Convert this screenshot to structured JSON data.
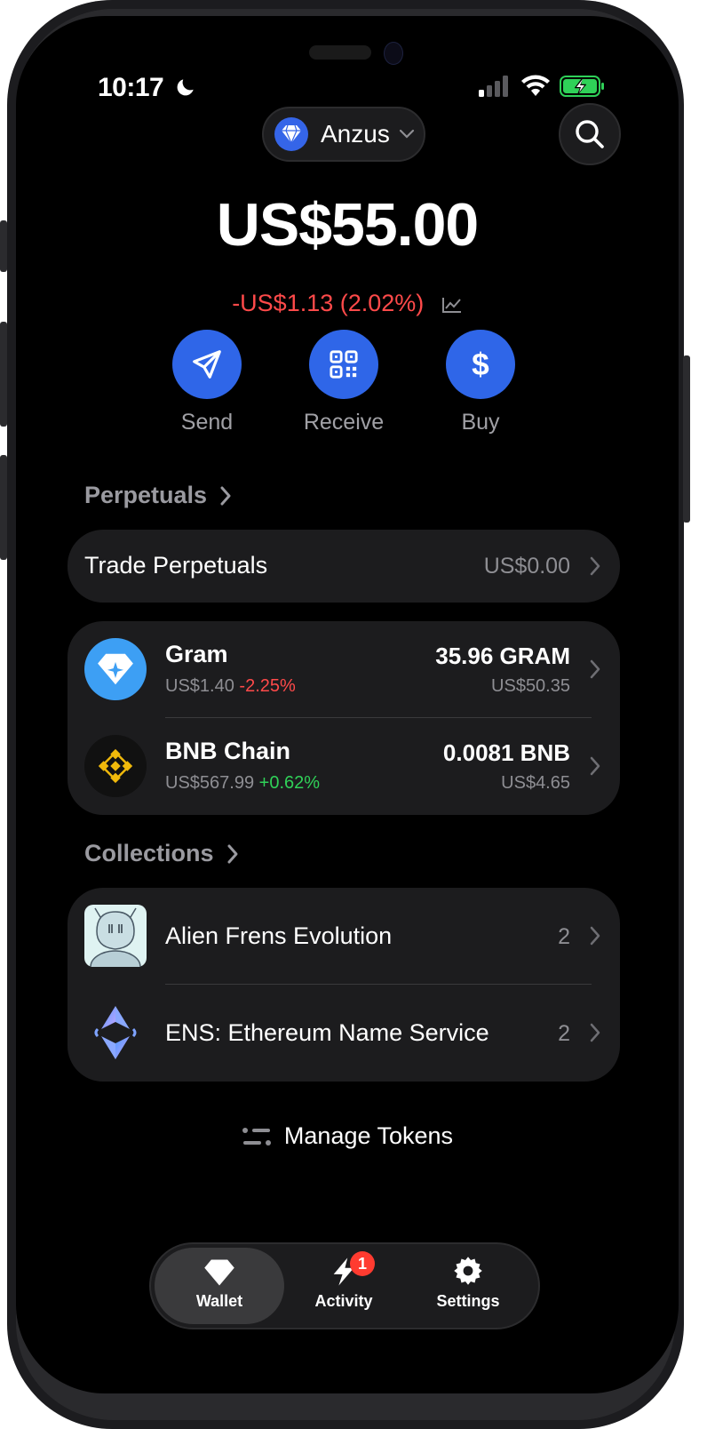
{
  "status_bar": {
    "time": "10:17"
  },
  "account": {
    "name": "Anzus"
  },
  "balance": {
    "total": "US$55.00",
    "change": "-US$1.13 (2.02%)"
  },
  "actions": [
    {
      "label": "Send"
    },
    {
      "label": "Receive"
    },
    {
      "label": "Buy"
    }
  ],
  "perpetuals": {
    "header": "Perpetuals",
    "trade_label": "Trade Perpetuals",
    "trade_value": "US$0.00"
  },
  "tokens": [
    {
      "name": "Gram",
      "price": "US$1.40",
      "change": "-2.25%",
      "amount": "35.96 GRAM",
      "fiat": "US$50.35"
    },
    {
      "name": "BNB Chain",
      "price": "US$567.99",
      "change": "+0.62%",
      "amount": "0.0081 BNB",
      "fiat": "US$4.65"
    }
  ],
  "collections": {
    "header": "Collections",
    "items": [
      {
        "name": "Alien Frens Evolution",
        "count": "2"
      },
      {
        "name": "ENS: Ethereum Name Service",
        "count": "2"
      }
    ]
  },
  "manage_tokens": "Manage Tokens",
  "tabbar": {
    "tabs": [
      {
        "label": "Wallet",
        "active": true
      },
      {
        "label": "Activity",
        "badge": "1"
      },
      {
        "label": "Settings"
      }
    ]
  },
  "colors": {
    "accent": "#2f66e8",
    "negative": "#ff4a4a",
    "positive": "#30d158",
    "card": "#1c1c1e"
  }
}
